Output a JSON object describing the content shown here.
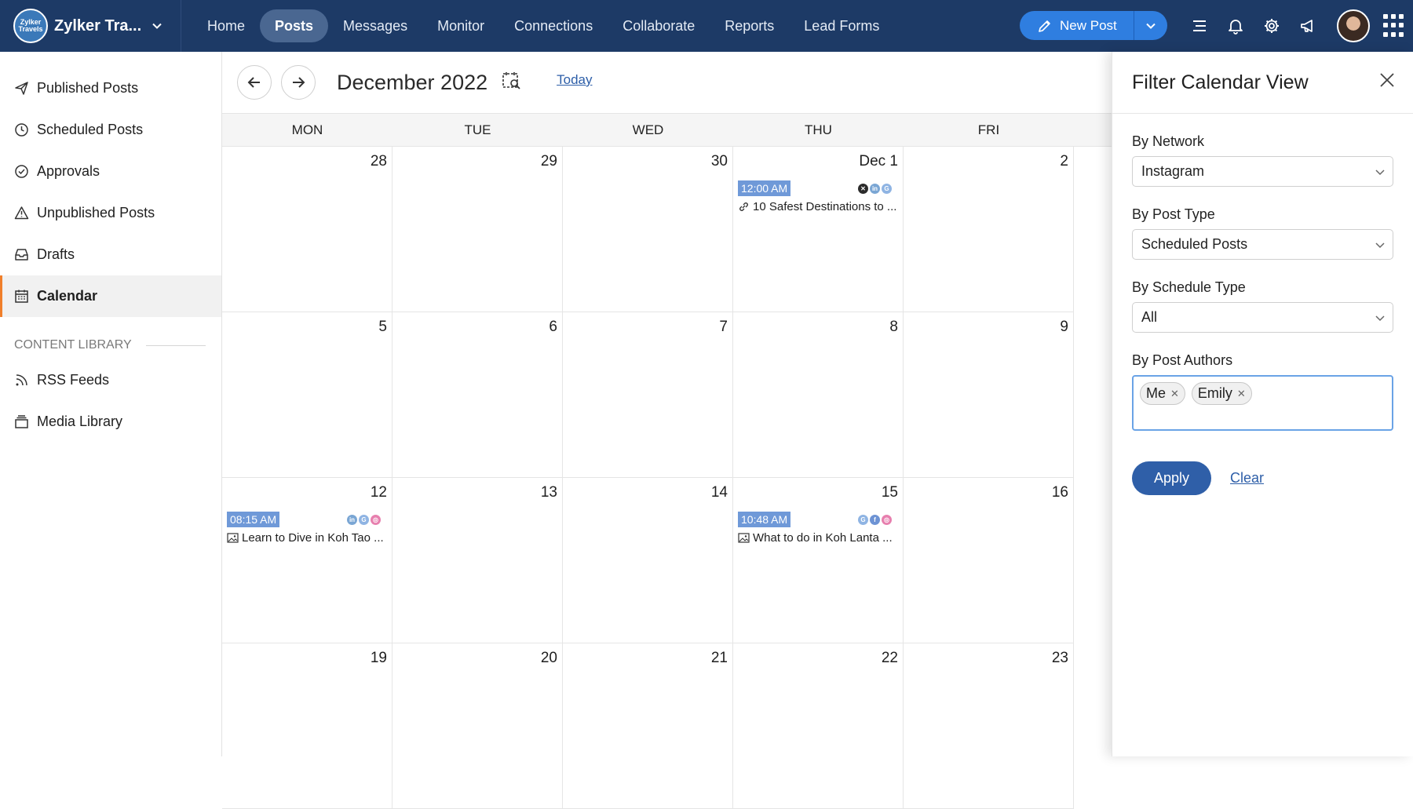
{
  "app": {
    "brand": {
      "name": "Zylker Tra...",
      "logo_text": "Zylker Travels"
    },
    "nav": [
      "Home",
      "Posts",
      "Messages",
      "Monitor",
      "Connections",
      "Collaborate",
      "Reports",
      "Lead Forms"
    ],
    "nav_active": "Posts",
    "new_post_label": "New Post",
    "top_icons": [
      "menu-icon",
      "bell-icon",
      "gear-icon",
      "megaphone-icon"
    ]
  },
  "sidebar": {
    "items": [
      {
        "label": "Published Posts",
        "icon": "paper-plane-icon"
      },
      {
        "label": "Scheduled Posts",
        "icon": "clock-icon"
      },
      {
        "label": "Approvals",
        "icon": "check-circle-icon"
      },
      {
        "label": "Unpublished Posts",
        "icon": "warning-icon"
      },
      {
        "label": "Drafts",
        "icon": "inbox-icon"
      },
      {
        "label": "Calendar",
        "icon": "calendar-icon",
        "active": true
      }
    ],
    "section_title": "CONTENT LIBRARY",
    "library": [
      {
        "label": "RSS Feeds",
        "icon": "rss-icon"
      },
      {
        "label": "Media Library",
        "icon": "stack-icon"
      }
    ]
  },
  "calendar": {
    "title": "December 2022",
    "today_label": "Today",
    "days_of_week": [
      "MON",
      "TUE",
      "WED",
      "THU",
      "FRI"
    ],
    "weeks": [
      [
        "28",
        "29",
        "30",
        "Dec 1",
        "2"
      ],
      [
        "5",
        "6",
        "7",
        "8",
        "9"
      ],
      [
        "12",
        "13",
        "14",
        "15",
        "16"
      ],
      [
        "19",
        "20",
        "21",
        "22",
        "23"
      ]
    ],
    "events": [
      {
        "week": 0,
        "day": 3,
        "time": "12:00 AM",
        "title": "10 Safest Destinations to ...",
        "type": "link-icon",
        "networks": [
          "x",
          "linkedin",
          "google"
        ]
      },
      {
        "week": 2,
        "day": 0,
        "time": "08:15 AM",
        "title": "Learn to Dive in Koh Tao ...",
        "type": "image-icon",
        "networks": [
          "linkedin",
          "google",
          "instagram"
        ]
      },
      {
        "week": 2,
        "day": 3,
        "time": "10:48 AM",
        "title": "What to do in Koh Lanta ...",
        "type": "image-icon",
        "networks": [
          "google",
          "facebook",
          "instagram"
        ]
      }
    ],
    "network_colors": {
      "x": "#2b2b2b",
      "linkedin": "#7aa6d4",
      "google": "#8fb4e3",
      "instagram": "#e77fae",
      "facebook": "#6d93d4"
    }
  },
  "filter": {
    "title": "Filter Calendar View",
    "network_label": "By Network",
    "network_value": "Instagram",
    "post_type_label": "By Post Type",
    "post_type_value": "Scheduled Posts",
    "schedule_type_label": "By Schedule Type",
    "schedule_type_value": "All",
    "authors_label": "By Post Authors",
    "authors": [
      "Me",
      "Emily"
    ],
    "apply_label": "Apply",
    "clear_label": "Clear"
  }
}
